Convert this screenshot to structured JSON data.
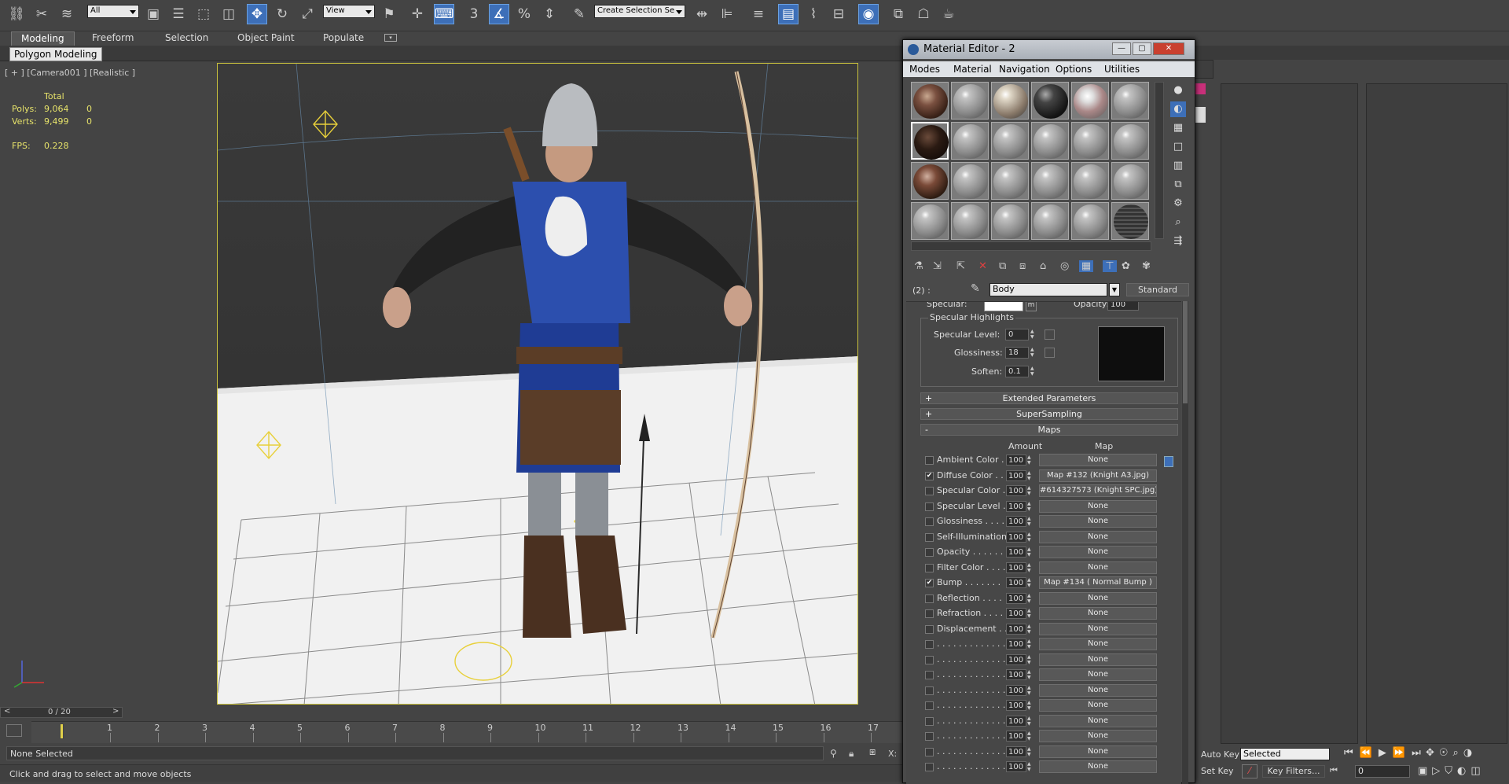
{
  "toolbar": {
    "selection_filter": "All",
    "ref_coord": "View",
    "named_selection": "Create Selection Se"
  },
  "ribbon": {
    "tabs": [
      "Modeling",
      "Freeform",
      "Selection",
      "Object Paint",
      "Populate"
    ],
    "sub_tab": "Polygon Modeling"
  },
  "viewport": {
    "label": "[ + ] [Camera001 ] [Realistic ]",
    "stats_header": "Total",
    "polys_label": "Polys:",
    "polys_total": "9,064",
    "polys_sel": "0",
    "verts_label": "Verts:",
    "verts_total": "9,499",
    "verts_sel": "0",
    "fps_label": "FPS:",
    "fps_value": "0.228"
  },
  "timeline": {
    "frame_counter": "0 / 20",
    "ticks": [
      "1",
      "2",
      "3",
      "4",
      "5",
      "6",
      "7",
      "8",
      "9",
      "10",
      "11",
      "12",
      "13",
      "14",
      "15",
      "16",
      "17"
    ]
  },
  "status": {
    "selection": "None Selected",
    "prompt": "Click and drag to select and move objects"
  },
  "animation": {
    "auto_key": "Auto Key",
    "set_key": "Set Key",
    "key_mode": "Selected",
    "key_filters": "Key Filters...",
    "frame": "0"
  },
  "material_editor": {
    "title": "Material Editor - 2",
    "menus": [
      "Modes",
      "Material",
      "Navigation",
      "Options",
      "Utilities"
    ],
    "slot_id": "(2) :",
    "material_name": "Body",
    "material_type": "Standard",
    "specular_label": "Specular:",
    "opacity_label": "Opacity:",
    "opacity_value": "100",
    "highlights": {
      "title": "Specular Highlights",
      "level_label": "Specular Level:",
      "level_value": "0",
      "gloss_label": "Glossiness:",
      "gloss_value": "18",
      "soften_label": "Soften:",
      "soften_value": "0.1"
    },
    "rollouts": {
      "extended": "Extended Parameters",
      "supersampling": "SuperSampling",
      "maps": "Maps"
    },
    "maps_header": {
      "amount": "Amount",
      "map": "Map"
    },
    "maps": [
      {
        "label": "Ambient Color . .",
        "checked": false,
        "amount": "100",
        "map": "None"
      },
      {
        "label": "Diffuse Color . . .",
        "checked": true,
        "amount": "100",
        "map": "Map #132 (Knight A3.jpg)"
      },
      {
        "label": "Specular Color . .",
        "checked": false,
        "amount": "100",
        "map": "#614327573 (Knight SPC.jpg)"
      },
      {
        "label": "Specular Level  .",
        "checked": false,
        "amount": "100",
        "map": "None"
      },
      {
        "label": "Glossiness  . . . .",
        "checked": false,
        "amount": "100",
        "map": "None"
      },
      {
        "label": "Self-Illumination .",
        "checked": false,
        "amount": "100",
        "map": "None"
      },
      {
        "label": "Opacity . . . . . .",
        "checked": false,
        "amount": "100",
        "map": "None"
      },
      {
        "label": "Filter Color  . . . .",
        "checked": false,
        "amount": "100",
        "map": "None"
      },
      {
        "label": "Bump  . . . . . . .",
        "checked": true,
        "amount": "100",
        "map": "Map #134  ( Normal Bump )"
      },
      {
        "label": "Reflection  . . . .",
        "checked": false,
        "amount": "100",
        "map": "None"
      },
      {
        "label": "Refraction  . . . .",
        "checked": false,
        "amount": "100",
        "map": "None"
      },
      {
        "label": "Displacement . .",
        "checked": false,
        "amount": "100",
        "map": "None"
      },
      {
        "label": ". . . . . . . . . . . . .",
        "checked": false,
        "amount": "100",
        "map": "None"
      },
      {
        "label": ". . . . . . . . . . . . .",
        "checked": false,
        "amount": "100",
        "map": "None"
      },
      {
        "label": ". . . . . . . . . . . . .",
        "checked": false,
        "amount": "100",
        "map": "None"
      },
      {
        "label": ". . . . . . . . . . . . .",
        "checked": false,
        "amount": "100",
        "map": "None"
      },
      {
        "label": ". . . . . . . . . . . . .",
        "checked": false,
        "amount": "100",
        "map": "None"
      },
      {
        "label": ". . . . . . . . . . . . .",
        "checked": false,
        "amount": "100",
        "map": "None"
      },
      {
        "label": ". . . . . . . . . . . . .",
        "checked": false,
        "amount": "100",
        "map": "None"
      },
      {
        "label": ". . . . . . . . . . . . .",
        "checked": false,
        "amount": "100",
        "map": "None"
      },
      {
        "label": ". . . . . . . . . . . . .",
        "checked": false,
        "amount": "100",
        "map": "None"
      }
    ]
  }
}
